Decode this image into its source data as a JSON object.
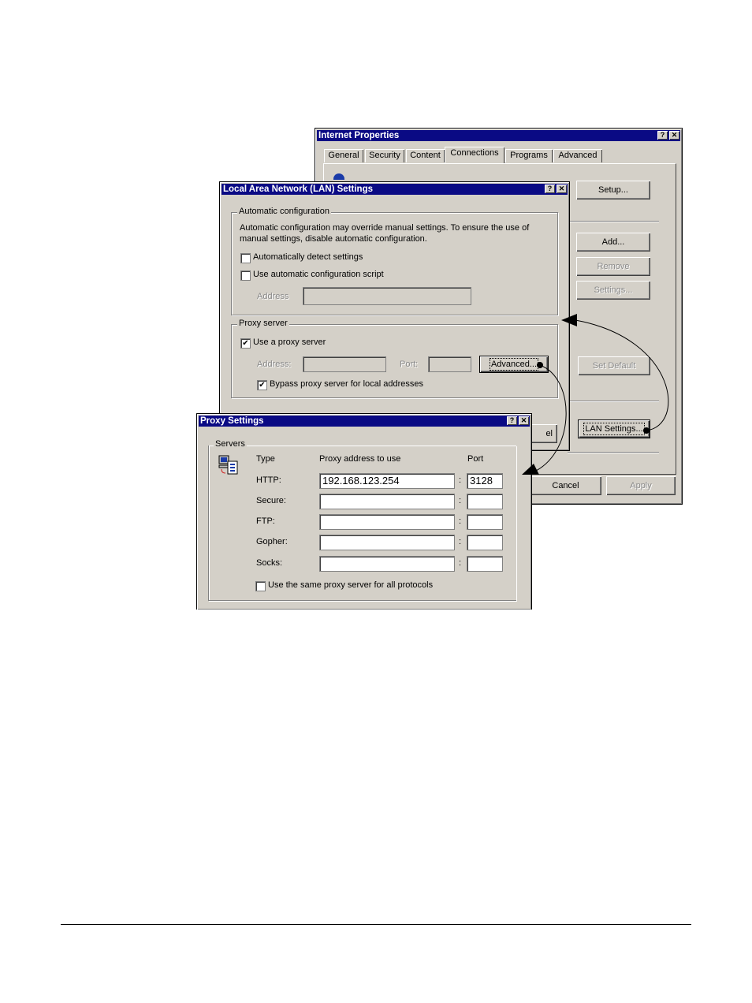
{
  "internet_properties": {
    "title": "Internet Properties",
    "help_label": "?",
    "close_label": "✕",
    "tabs": [
      {
        "label": "General",
        "active": false
      },
      {
        "label": "Security",
        "active": false
      },
      {
        "label": "Content",
        "active": false
      },
      {
        "label": "Connections",
        "active": true
      },
      {
        "label": "Programs",
        "active": false
      },
      {
        "label": "Advanced",
        "active": false
      }
    ],
    "buttons": {
      "setup": "Setup...",
      "add": "Add...",
      "remove": "Remove",
      "settings": "Settings...",
      "set_default": "Set Default",
      "lan_settings": "LAN Settings...",
      "cancel": "Cancel",
      "apply": "Apply"
    }
  },
  "lan_settings": {
    "title": "Local Area Network (LAN) Settings",
    "help_label": "?",
    "close_label": "✕",
    "auto_config": {
      "group_label": "Automatic configuration",
      "description_line1": "Automatic configuration may override manual settings.  To ensure the use of",
      "description_line2": "manual settings, disable automatic configuration.",
      "auto_detect_label": "Automatically detect settings",
      "auto_detect_checked": false,
      "use_script_label": "Use automatic configuration script",
      "use_script_checked": false,
      "address_label": "Address",
      "address_value": ""
    },
    "proxy_server": {
      "group_label": "Proxy server",
      "use_proxy_label": "Use a proxy server",
      "use_proxy_checked": true,
      "address_label": "Address:",
      "address_value": "",
      "port_label": "Port:",
      "port_value": "",
      "advanced_button": "Advanced...",
      "bypass_label": "Bypass proxy server for local addresses",
      "bypass_checked": true
    },
    "cancel_partial": "el"
  },
  "proxy_settings": {
    "title": "Proxy Settings",
    "help_label": "?",
    "close_label": "✕",
    "servers_label": "Servers",
    "col_type": "Type",
    "col_address": "Proxy address to use",
    "col_port": "Port",
    "separator": ":",
    "rows": [
      {
        "type": "HTTP:",
        "address": "192.168.123.254",
        "port": "3128"
      },
      {
        "type": "Secure:",
        "address": "",
        "port": ""
      },
      {
        "type": "FTP:",
        "address": "",
        "port": ""
      },
      {
        "type": "Gopher:",
        "address": "",
        "port": ""
      },
      {
        "type": "Socks:",
        "address": "",
        "port": ""
      }
    ],
    "same_proxy_label": "Use the same proxy server for all protocols",
    "same_proxy_checked": false
  },
  "glyphs": {
    "check": "✔"
  }
}
